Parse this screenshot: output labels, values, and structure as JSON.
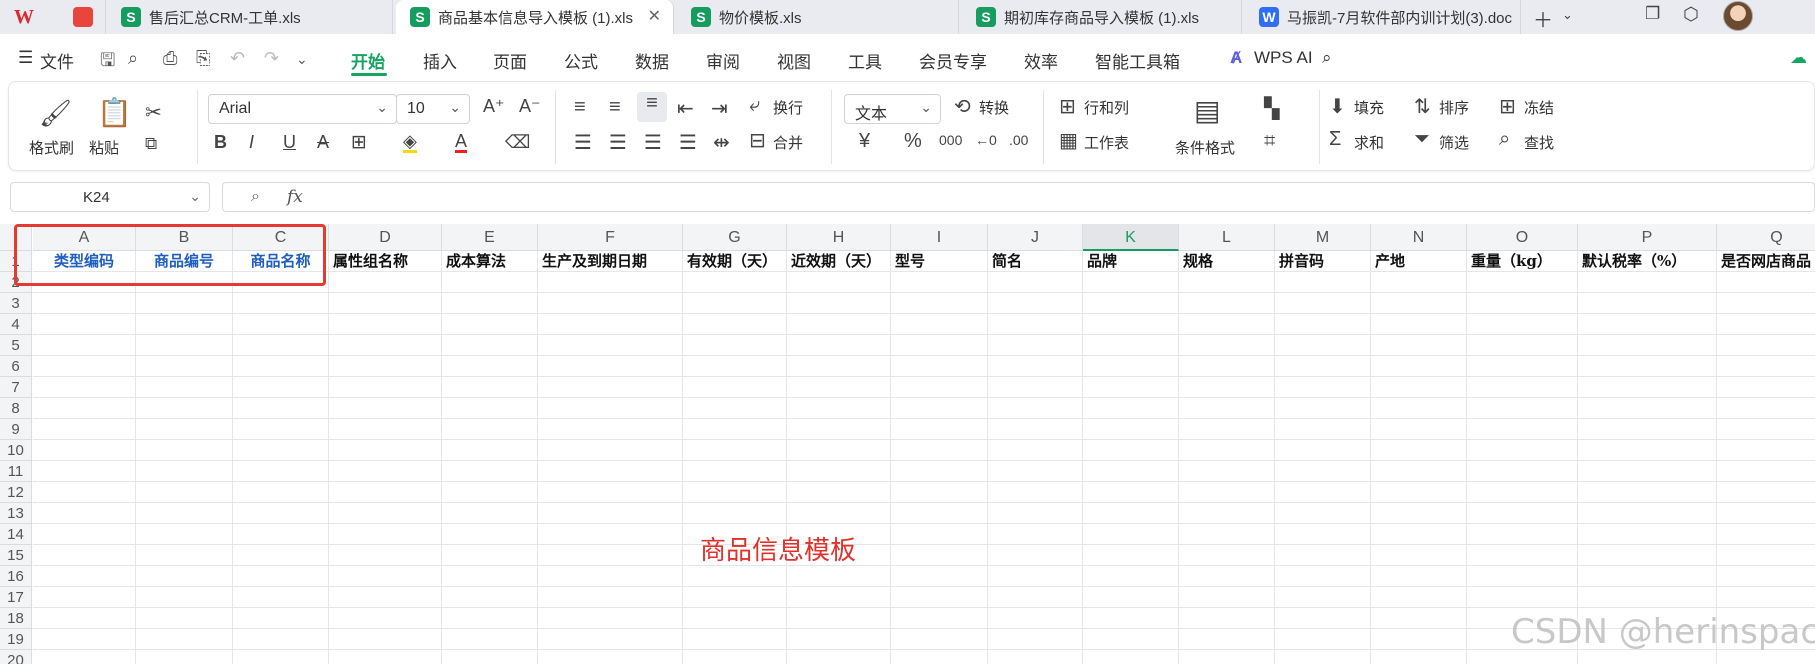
{
  "tabs": [
    {
      "label": "售后汇总CRM-工单.xls",
      "type": "s",
      "active": false
    },
    {
      "label": "商品基本信息导入模板 (1).xls",
      "type": "s",
      "active": true
    },
    {
      "label": "物价模板.xls",
      "type": "s",
      "active": false
    },
    {
      "label": "期初库存商品导入模板 (1).xls",
      "type": "s",
      "active": false
    },
    {
      "label": "马振凯-7月软件部内训计划(3).doc",
      "type": "w",
      "active": false
    }
  ],
  "menu": {
    "file": "文件",
    "items": [
      "开始",
      "插入",
      "页面",
      "公式",
      "数据",
      "审阅",
      "视图",
      "工具",
      "会员专享",
      "效率",
      "智能工具箱"
    ],
    "wps_ai": "WPS AI"
  },
  "ribbon": {
    "format_painter": "格式刷",
    "paste": "粘贴",
    "font_name": "Arial",
    "font_size": "10",
    "wrap": "换行",
    "merge": "合并",
    "number_format": "文本",
    "convert": "转换",
    "row_col": "行和列",
    "worksheet": "工作表",
    "cond_format": "条件格式",
    "fill": "填充",
    "sort": "排序",
    "freeze": "冻结",
    "sum": "求和",
    "filter": "筛选",
    "find": "查找"
  },
  "formula_bar": {
    "cell_ref": "K24",
    "fx": "fx",
    "value": ""
  },
  "grid": {
    "columns": [
      "A",
      "B",
      "C",
      "D",
      "E",
      "F",
      "G",
      "H",
      "I",
      "J",
      "K",
      "L",
      "M",
      "N",
      "O",
      "P",
      "Q"
    ],
    "selected_column": "K",
    "rows": [
      "1",
      "2",
      "3",
      "4",
      "5",
      "6",
      "7",
      "8",
      "9",
      "10",
      "11",
      "12",
      "13",
      "14",
      "15",
      "16",
      "17",
      "18",
      "19",
      "20"
    ],
    "header_row": [
      "类型编码",
      "商品编号",
      "商品名称",
      "属性组名称",
      "成本算法",
      "生产及到期日期",
      "有效期（天）",
      "近效期（天）",
      "型号",
      "简名",
      "品牌",
      "规格",
      "拼音码",
      "产地",
      "重量（kg）",
      "默认税率（%）",
      "是否网店商品"
    ]
  },
  "annotation": "商品信息模板",
  "watermark": "CSDN @herinspace",
  "colors": {
    "accent": "#17a462",
    "highlight_red": "#e53a32",
    "header_blue": "#1f5fbf"
  }
}
